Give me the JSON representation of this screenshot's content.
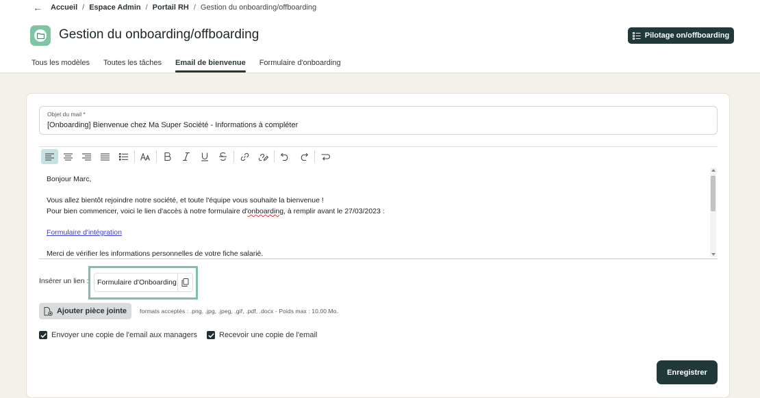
{
  "breadcrumb": {
    "items": [
      "Accueil",
      "Espace Admin",
      "Portail RH"
    ],
    "current": "Gestion du onboarding/offboarding"
  },
  "header": {
    "title": "Gestion du onboarding/offboarding",
    "pilot_button": "Pilotage on/offboarding",
    "app_icon": "folder-icon"
  },
  "tabs": [
    {
      "label": "Tous les modèles",
      "active": false
    },
    {
      "label": "Toutes les tâches",
      "active": false
    },
    {
      "label": "Email de bienvenue",
      "active": true
    },
    {
      "label": "Formulaire d'onboarding",
      "active": false
    }
  ],
  "subject": {
    "label": "Objet du mail *",
    "value": "[Onboarding] Bienvenue chez Ma Super Société - Informations à compléter"
  },
  "editor": {
    "greeting": "Bonjour Marc,",
    "line1": "Vous allez bientôt rejoindre notre société, et toute l'équipe vous souhaite la bienvenue !",
    "line2_before": "Pour bien commencer, voici le lien d'accès à notre formulaire d'",
    "line2_word": "onboarding",
    "line2_after": ", à remplir avant le 27/03/2023 :",
    "link": "Formulaire d'intégration",
    "line3": "Merci de vérifier les informations personnelles de votre fiche salarié."
  },
  "insert_link": {
    "label": "Insérer un lien :",
    "value": "Formulaire d'Onboarding"
  },
  "attachment": {
    "button": "Ajouter pièce jointe",
    "formats": "formats acceptés : .png, .jpg, .jpeg, .gif, .pdf, .docx - Poids max : 10.00 Mo."
  },
  "checkboxes": [
    {
      "label": "Envoyer une copie de l'email aux managers",
      "checked": true
    },
    {
      "label": "Recevoir une copie de l'email",
      "checked": true
    }
  ],
  "save_button": "Enregistrer",
  "colors": {
    "primary": "#22393a",
    "accent_green": "#7fc4a3",
    "highlight_border": "#7fc1a2",
    "link": "#3d3fd1",
    "page_bg": "#f4f1ea"
  }
}
